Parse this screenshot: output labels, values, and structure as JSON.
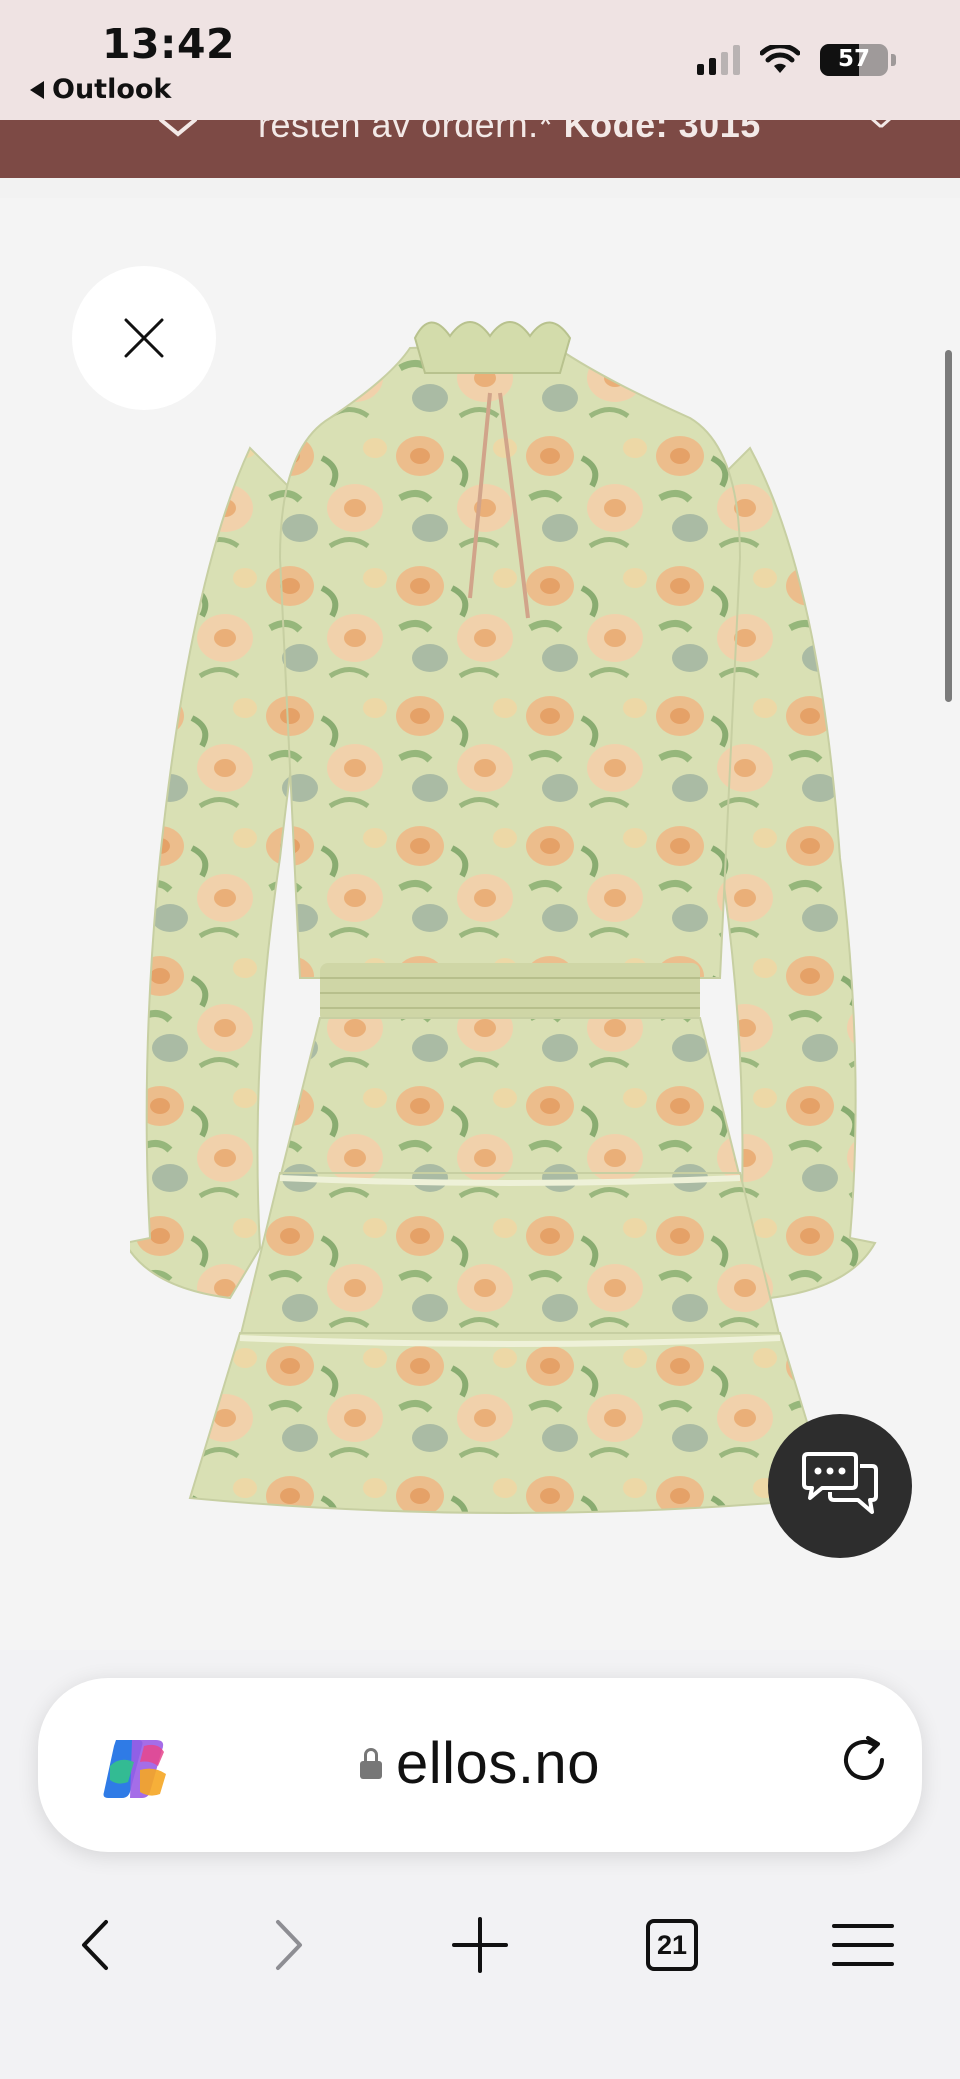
{
  "status_bar": {
    "time": "13:42",
    "back_app": "Outlook",
    "battery_level": "57"
  },
  "promo": {
    "text": "resten av ordern.*",
    "code": "Kode: 3015"
  },
  "product": {
    "image_alt": "Floral tiered long-sleeve dress",
    "colors": {
      "fabric": "#d9e0b4",
      "flower_peach": "#f0b885",
      "leaf_green": "#6f9b5a"
    }
  },
  "browser": {
    "url": "ellos.no",
    "tabs_count": "21"
  }
}
